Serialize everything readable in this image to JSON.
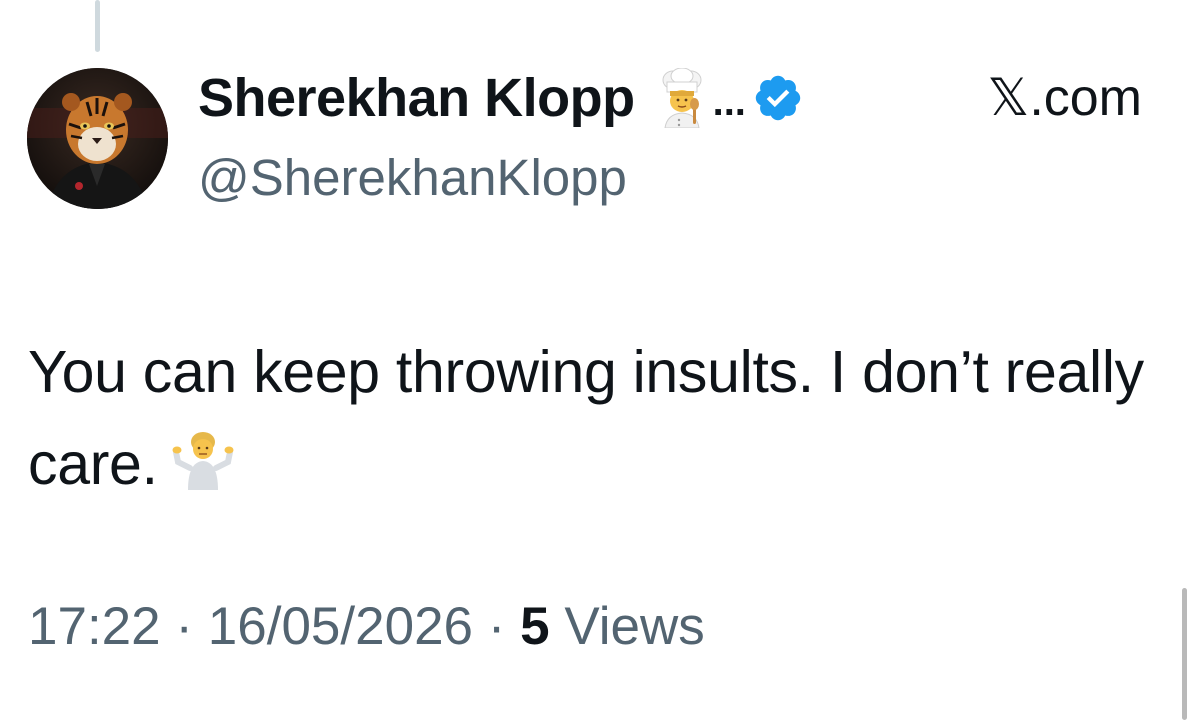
{
  "tweet": {
    "author": {
      "display_name": "Sherekhan Klopp",
      "name_emoji": "chef-emoji",
      "truncation": "...",
      "verified": true,
      "handle": "@SherekhanKlopp",
      "avatar": "tiger-avatar"
    },
    "source_label": "𝕏.com",
    "text_main": "You can keep throwing insults. I don’t really care.",
    "text_emoji": "person-shrugging-emoji",
    "time": "17:22",
    "separator": "·",
    "date": "16/05/2026",
    "views_count": "5",
    "views_label": "Views"
  },
  "colors": {
    "primary_text": "#0f1419",
    "secondary_text": "#536471",
    "verified_badge": "#1d9bf0",
    "thread_line": "#cfd9de"
  }
}
